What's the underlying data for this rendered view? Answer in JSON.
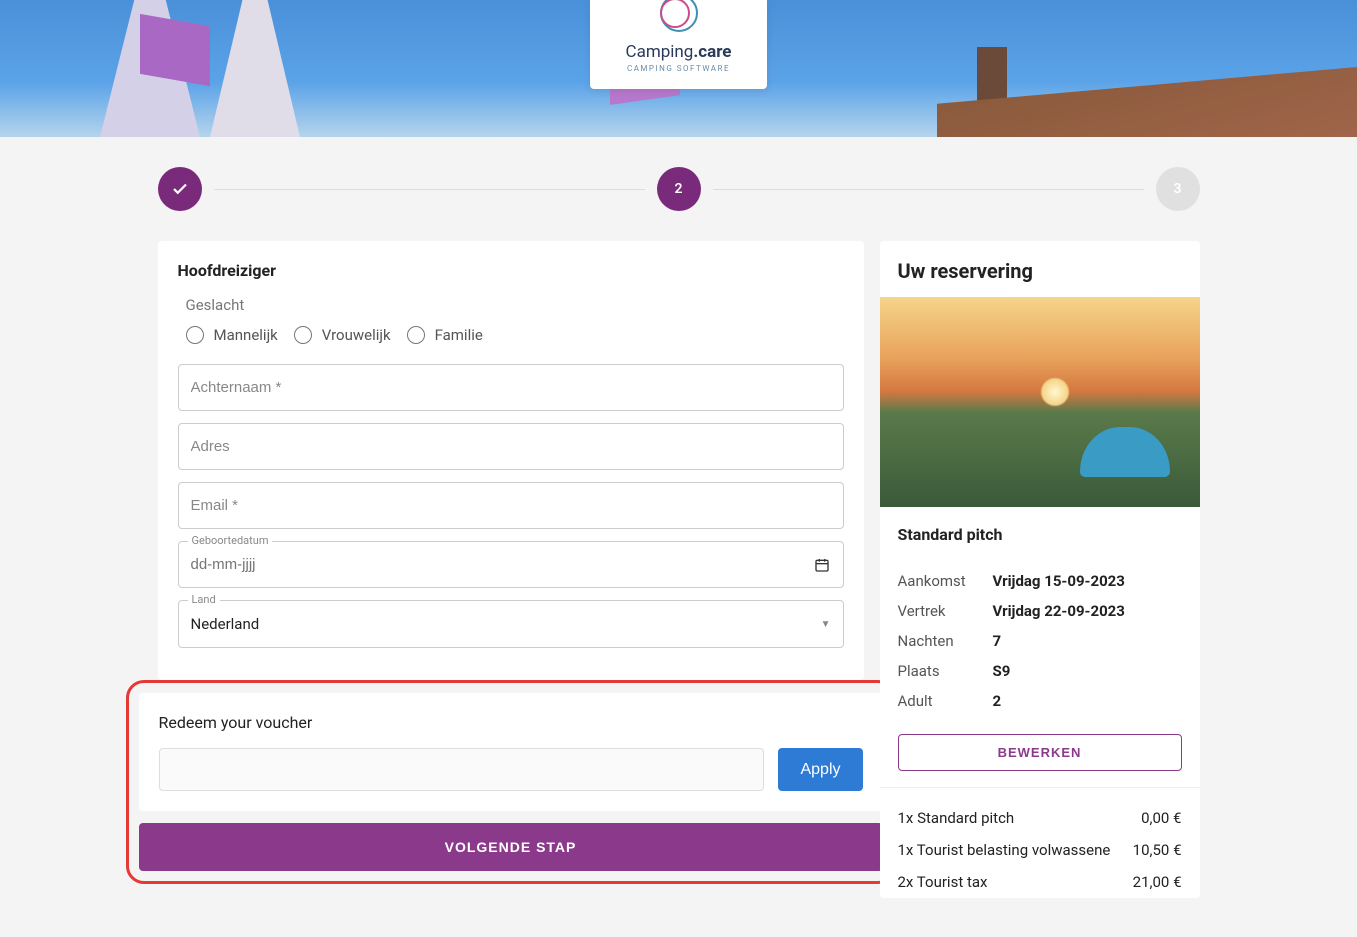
{
  "logo": {
    "name": "Camping",
    "suffix": ".care",
    "tagline": "CAMPING SOFTWARE"
  },
  "steps": {
    "step2": "2",
    "step3": "3"
  },
  "form": {
    "title": "Hoofdreiziger",
    "genderLabel": "Geslacht",
    "genders": {
      "male": "Mannelijk",
      "female": "Vrouwelijk",
      "family": "Familie"
    },
    "lastnamePlaceholder": "Achternaam *",
    "addressPlaceholder": "Adres",
    "emailPlaceholder": "Email *",
    "dobLabel": "Geboortedatum",
    "dobPlaceholder": "dd-mm-jjjj",
    "countryLabel": "Land",
    "countryValue": "Nederland"
  },
  "voucher": {
    "title": "Redeem your voucher",
    "apply": "Apply"
  },
  "nextButton": "VOLGENDE STAP",
  "reservation": {
    "title": "Uw reservering",
    "pitchName": "Standard pitch",
    "rows": {
      "arrival": {
        "k": "Aankomst",
        "v": "Vrijdag 15-09-2023"
      },
      "departure": {
        "k": "Vertrek",
        "v": "Vrijdag 22-09-2023"
      },
      "nights": {
        "k": "Nachten",
        "v": "7"
      },
      "place": {
        "k": "Plaats",
        "v": "S9"
      },
      "adult": {
        "k": "Adult",
        "v": "2"
      }
    },
    "editBtn": "BEWERKEN",
    "prices": [
      {
        "label": "1x Standard pitch",
        "value": "0,00 €"
      },
      {
        "label": "1x Tourist belasting volwassene",
        "value": "10,50 €"
      },
      {
        "label": "2x Tourist tax",
        "value": "21,00 €"
      }
    ]
  }
}
